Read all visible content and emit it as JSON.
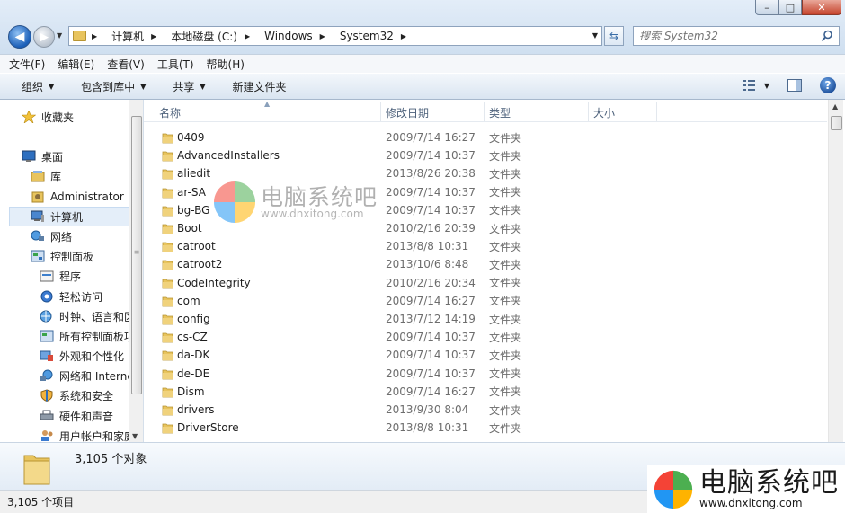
{
  "window": {
    "minimize_glyph": "–",
    "maximize_glyph": "□",
    "close_glyph": "✕"
  },
  "address": {
    "crumbs": [
      "计算机",
      "本地磁盘 (C:)",
      "Windows",
      "System32"
    ]
  },
  "search": {
    "placeholder": "搜索 System32"
  },
  "menu": [
    "文件(F)",
    "编辑(E)",
    "查看(V)",
    "工具(T)",
    "帮助(H)"
  ],
  "toolbar": {
    "organize": "组织",
    "include_in_library": "包含到库中",
    "share": "共享",
    "new_folder": "新建文件夹",
    "help": "?"
  },
  "nav": {
    "favorites": "收藏夹",
    "desktop": "桌面",
    "libraries": "库",
    "administrator": "Administrator",
    "computer": "计算机",
    "network": "网络",
    "control_panel": "控制面板",
    "programs": "程序",
    "ease_of_access": "轻松访问",
    "clock_language": "时钟、语言和区",
    "all_items": "所有控制面板项",
    "appearance": "外观和个性化",
    "network_internet": "网络和 Internet",
    "system_security": "系统和安全",
    "hardware_sound": "硬件和声音",
    "user_accounts": "用户帐户和家庭"
  },
  "columns": {
    "name": "名称",
    "date": "修改日期",
    "type": "类型",
    "size": "大小"
  },
  "files": [
    {
      "name": "0409",
      "date": "2009/7/14 16:27",
      "type": "文件夹"
    },
    {
      "name": "AdvancedInstallers",
      "date": "2009/7/14 10:37",
      "type": "文件夹"
    },
    {
      "name": "aliedit",
      "date": "2013/8/26 20:38",
      "type": "文件夹"
    },
    {
      "name": "ar-SA",
      "date": "2009/7/14 10:37",
      "type": "文件夹"
    },
    {
      "name": "bg-BG",
      "date": "2009/7/14 10:37",
      "type": "文件夹"
    },
    {
      "name": "Boot",
      "date": "2010/2/16 20:39",
      "type": "文件夹"
    },
    {
      "name": "catroot",
      "date": "2013/8/8 10:31",
      "type": "文件夹"
    },
    {
      "name": "catroot2",
      "date": "2013/10/6 8:48",
      "type": "文件夹"
    },
    {
      "name": "CodeIntegrity",
      "date": "2010/2/16 20:34",
      "type": "文件夹"
    },
    {
      "name": "com",
      "date": "2009/7/14 16:27",
      "type": "文件夹"
    },
    {
      "name": "config",
      "date": "2013/7/12 14:19",
      "type": "文件夹"
    },
    {
      "name": "cs-CZ",
      "date": "2009/7/14 10:37",
      "type": "文件夹"
    },
    {
      "name": "da-DK",
      "date": "2009/7/14 10:37",
      "type": "文件夹"
    },
    {
      "name": "de-DE",
      "date": "2009/7/14 10:37",
      "type": "文件夹"
    },
    {
      "name": "Dism",
      "date": "2009/7/14 16:27",
      "type": "文件夹"
    },
    {
      "name": "drivers",
      "date": "2013/9/30 8:04",
      "type": "文件夹"
    },
    {
      "name": "DriverStore",
      "date": "2013/8/8 10:31",
      "type": "文件夹"
    }
  ],
  "details": {
    "count": "3,105 个对象"
  },
  "status": {
    "items": "3,105 个项目"
  },
  "watermark": {
    "title": "电脑系统吧",
    "url": "www.dnxitong.com"
  },
  "colors": {
    "folder": "#e8c45e",
    "selection": "#e4eef9"
  }
}
